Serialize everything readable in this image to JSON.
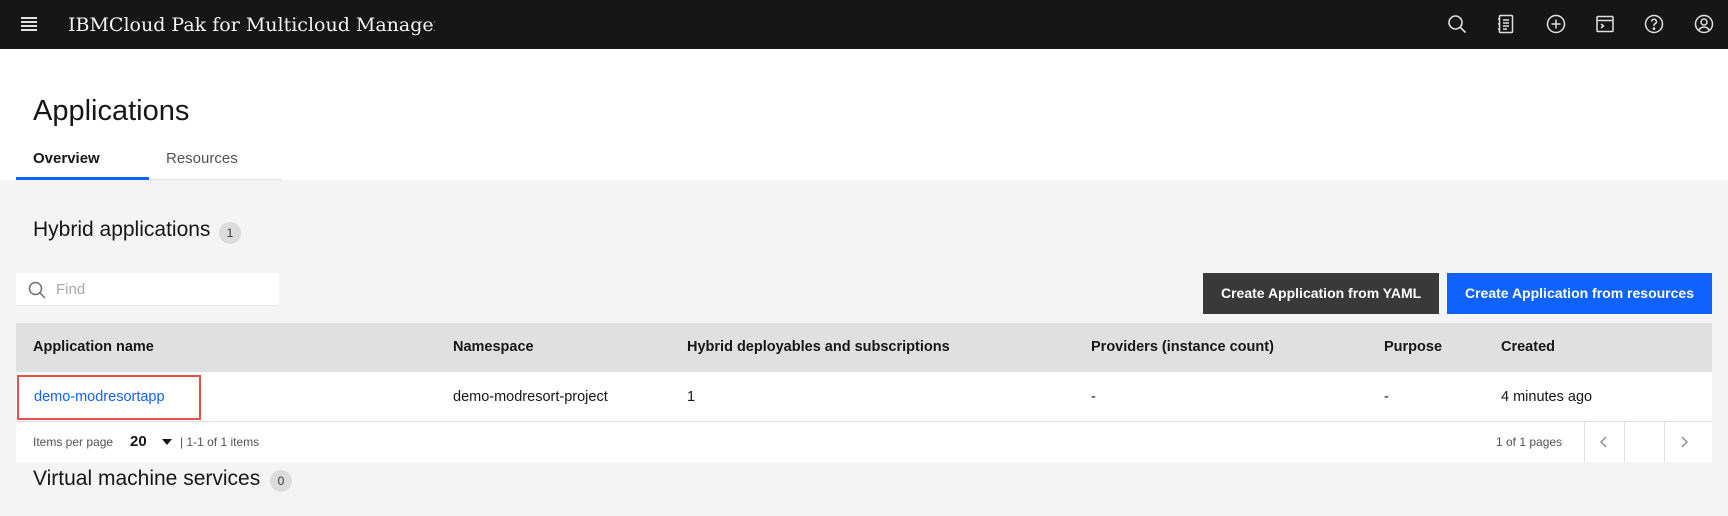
{
  "topbar": {
    "brand": "IBMCloud Pak for Multicloud Manager",
    "icons": [
      "menu-icon",
      "search-icon",
      "notes-icon",
      "add-icon",
      "terminal-icon",
      "help-icon",
      "user-icon"
    ]
  },
  "page": {
    "title": "Applications",
    "tabs": [
      {
        "label": "Overview",
        "selected": true
      },
      {
        "label": "Resources",
        "selected": false
      }
    ]
  },
  "hybrid": {
    "title": "Hybrid applications",
    "count": "1",
    "search_placeholder": "Find",
    "buttons": {
      "create_yaml": "Create Application from YAML",
      "create_resources": "Create Application from resources"
    },
    "columns": [
      "Application name",
      "Namespace",
      "Hybrid deployables and subscriptions",
      "Providers (instance count)",
      "Purpose",
      "Created"
    ],
    "rows": [
      {
        "name": "demo-modresortapp",
        "namespace": "demo-modresort-project",
        "deployables": "1",
        "providers": "-",
        "purpose": "-",
        "created": "4 minutes ago"
      }
    ],
    "pagination": {
      "items_per_page_label": "Items per page",
      "items_per_page": "20",
      "range": "|  1-1 of 1 items",
      "pages": "1 of 1 pages"
    }
  },
  "vm": {
    "title": "Virtual machine services",
    "count": "0"
  },
  "colors": {
    "topbar": "#161616",
    "primary": "#0f62fe",
    "secondary_button": "#393939",
    "highlight_box": "#e5534b",
    "content_bg": "#f4f4f4"
  }
}
